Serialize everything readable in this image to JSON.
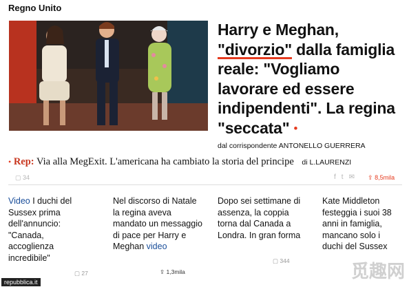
{
  "section": "Regno Unito",
  "headline": {
    "part1": "Harry e Meghan,",
    "quoted": "\"divorzio\"",
    "part2": " dalla famiglia reale: \"Vogliamo lavorare ed essere indipendenti\". La regina \"seccata\"",
    "dot": "•"
  },
  "byline": "dal corrispondente ANTONELLO GUERRERA",
  "related": {
    "bullet": "•",
    "label": "Rep:",
    "text": "Via alla MegExit. L'americana ha cambiato la storia del principe",
    "author": "di L.LAURENZI"
  },
  "share_top": {
    "count": "34",
    "shares": "8,5mila"
  },
  "columns": [
    {
      "link": "Video",
      "text": " I duchi del Sussex prima dell'annuncio: \"Canada, accoglienza incredibile\"",
      "count": "27"
    },
    {
      "text": "Nel discorso di Natale la regina aveva mandato un messaggio di pace per Harry e Meghan ",
      "link": "video",
      "shares": "1,3mila"
    },
    {
      "text": "Dopo sei settimane di assenza, la coppia torna dal Canada a Londra. In gran forma",
      "count": "344"
    },
    {
      "text": "Kate Middleton festeggia i suoi 38 anni in famiglia, mancano solo i duchi del Sussex"
    }
  ],
  "credit": "repubblica.it",
  "watermark": "觅趣网",
  "colors": {
    "accent": "#e53a1e",
    "link": "#1a4e9a"
  }
}
